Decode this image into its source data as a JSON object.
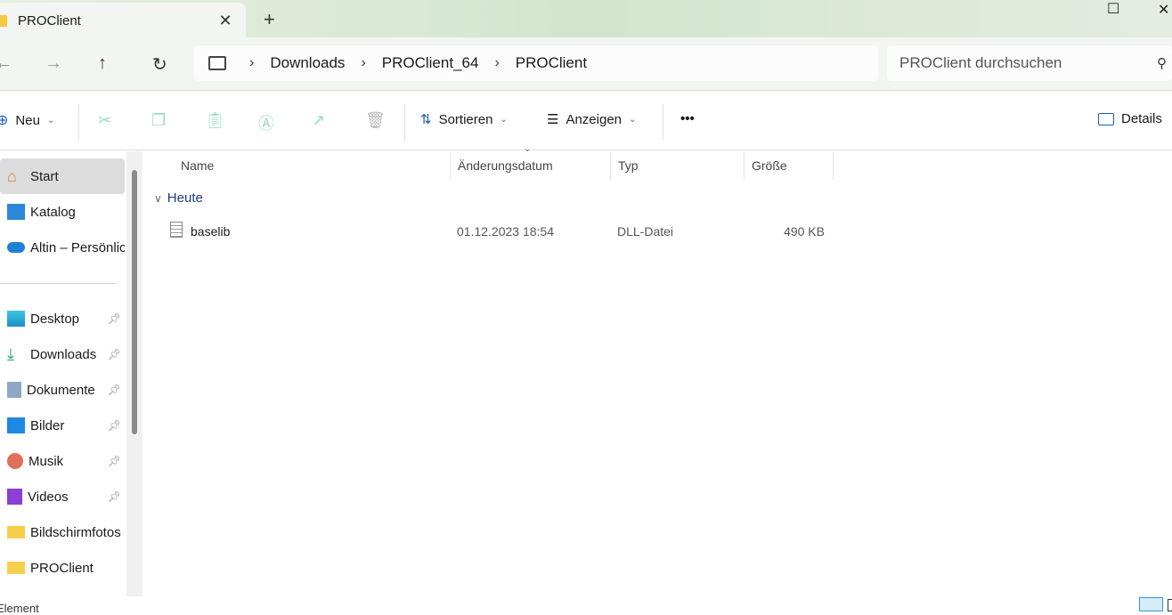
{
  "window": {
    "tab_title": "PROClient",
    "close_tab": "✕",
    "new_tab": "+",
    "minimize": "—",
    "maximize": "☐",
    "close": "✕"
  },
  "nav": {
    "back": "←",
    "forward": "→",
    "up": "↑",
    "refresh": "↻"
  },
  "breadcrumb": [
    "Downloads",
    "PROClient_64",
    "PROClient"
  ],
  "search": {
    "placeholder": "PROClient durchsuchen"
  },
  "toolbar": {
    "new": "Neu",
    "sort": "Sortieren",
    "view": "Anzeigen",
    "more": "•••",
    "details": "Details"
  },
  "sidebar": {
    "top": [
      {
        "label": "Start"
      },
      {
        "label": "Katalog"
      },
      {
        "label": "Altin – Persönlich"
      }
    ],
    "pinned": [
      {
        "label": "Desktop"
      },
      {
        "label": "Downloads"
      },
      {
        "label": "Dokumente"
      },
      {
        "label": "Bilder"
      },
      {
        "label": "Musik"
      },
      {
        "label": "Videos"
      },
      {
        "label": "Bildschirmfotos"
      },
      {
        "label": "PROClient"
      }
    ]
  },
  "columns": {
    "name": "Name",
    "date": "Änderungsdatum",
    "type": "Typ",
    "size": "Größe"
  },
  "groups": [
    {
      "label": "Heute",
      "files": [
        {
          "name": "baselib",
          "date": "01.12.2023 18:54",
          "type": "DLL-Datei",
          "size": "490 KB"
        }
      ]
    }
  ],
  "status": {
    "text": "Element"
  }
}
